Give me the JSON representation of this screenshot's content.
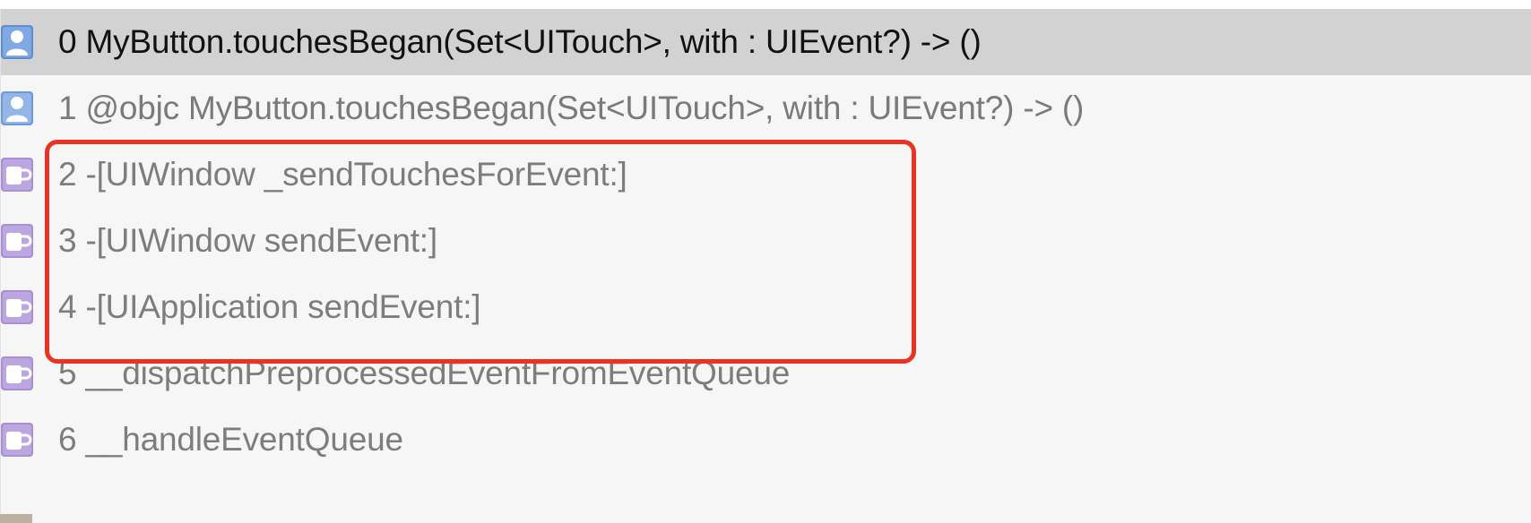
{
  "frames": [
    {
      "label": "0 MyButton.touchesBegan(Set<UITouch>, with : UIEvent?) -> ()",
      "kind": "user",
      "icon": "person-icon",
      "selected": true
    },
    {
      "label": "1 @objc MyButton.touchesBegan(Set<UITouch>, with : UIEvent?) -> ()",
      "kind": "user",
      "icon": "person-icon",
      "selected": false
    },
    {
      "label": "2 -[UIWindow _sendTouchesForEvent:]",
      "kind": "system",
      "icon": "mug-icon",
      "selected": false
    },
    {
      "label": "3 -[UIWindow sendEvent:]",
      "kind": "system",
      "icon": "mug-icon",
      "selected": false
    },
    {
      "label": "4 -[UIApplication sendEvent:]",
      "kind": "system",
      "icon": "mug-icon",
      "selected": false
    },
    {
      "label": "5 __dispatchPreprocessedEventFromEventQueue",
      "kind": "system",
      "icon": "mug-icon",
      "selected": false
    },
    {
      "label": "6 __handleEventQueue",
      "kind": "system",
      "icon": "mug-icon",
      "selected": false
    }
  ],
  "colors": {
    "user_icon": "#5b8fd1",
    "system_icon": "#a98fd4",
    "selection": "#d2d2d2",
    "highlight_box": "#ea3323"
  }
}
